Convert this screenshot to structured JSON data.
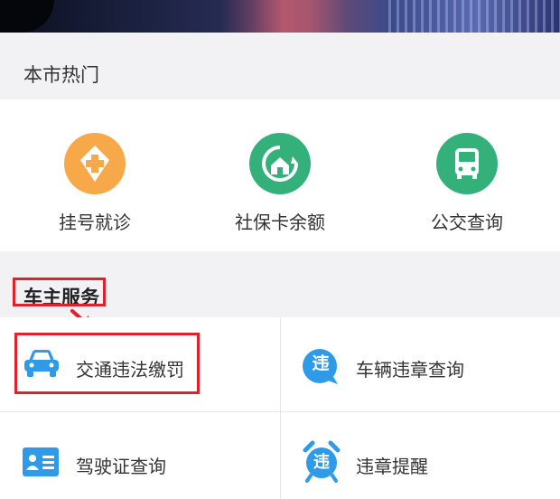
{
  "banner": {
    "icon": "city-night-banner"
  },
  "hot_section": {
    "title": "本市热门",
    "items": [
      {
        "label": "挂号就诊",
        "icon": "medical-plus-icon",
        "color": "#f7a94a"
      },
      {
        "label": "社保卡余额",
        "icon": "home-refresh-icon",
        "color": "#34b07a"
      },
      {
        "label": "公交查询",
        "icon": "bus-icon",
        "color": "#34b07a"
      }
    ]
  },
  "owner_section": {
    "title": "车主服务",
    "items": [
      {
        "label": "交通违法缴罚",
        "icon": "car-icon",
        "color": "#2f9be8"
      },
      {
        "label": "车辆违章查询",
        "icon": "violation-icon",
        "color": "#2f9be8"
      },
      {
        "label": "驾驶证查询",
        "icon": "id-card-icon",
        "color": "#2f9be8"
      },
      {
        "label": "违章提醒",
        "icon": "alarm-violation-icon",
        "color": "#2f9be8"
      }
    ]
  },
  "icon_glyph": "违",
  "colors": {
    "highlight": "#e0202a",
    "background": "#f2f2f4"
  }
}
